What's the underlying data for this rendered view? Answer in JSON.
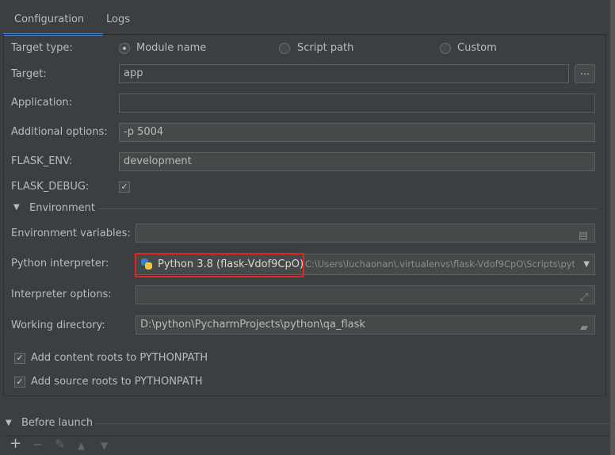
{
  "tabs": [
    {
      "label": "Configuration",
      "active": true
    },
    {
      "label": "Logs",
      "active": false
    }
  ],
  "target_type": {
    "label": "Target type:",
    "options": [
      {
        "label": "Module name",
        "selected": true
      },
      {
        "label": "Script path",
        "selected": false
      },
      {
        "label": "Custom",
        "selected": false
      }
    ]
  },
  "target": {
    "label": "Target:",
    "value": "app",
    "browse_label": "..."
  },
  "application": {
    "label": "Application:",
    "value": ""
  },
  "additional_options": {
    "label": "Additional options:",
    "value": "-p 5004"
  },
  "flask_env": {
    "label": "FLASK_ENV:",
    "value": "development"
  },
  "flask_debug": {
    "label": "FLASK_DEBUG:",
    "checked": true
  },
  "environment": {
    "title": "Environment",
    "env_vars": {
      "label": "Environment variables:",
      "value": ""
    },
    "interpreter": {
      "label": "Python interpreter:",
      "name": "Python 3.8 (flask-Vdof9CpO)",
      "path": "C:\\Users\\luchaonan\\.virtualenvs\\flask-Vdof9CpO\\Scripts\\pyt",
      "highlight_color": "#e8231f"
    },
    "interpreter_options": {
      "label": "Interpreter options:",
      "value": ""
    },
    "working_dir": {
      "label": "Working directory:",
      "value": "D:\\python\\PycharmProjects\\python\\qa_flask"
    },
    "content_roots": {
      "label": "Add content roots to PYTHONPATH",
      "checked": true
    },
    "source_roots": {
      "label": "Add source roots to PYTHONPATH",
      "checked": true
    }
  },
  "before_launch": {
    "title": "Before launch",
    "toolbar": [
      "add-icon",
      "remove-icon",
      "edit-icon",
      "move-up-icon",
      "move-down-icon"
    ]
  },
  "colors": {
    "background": "#3c3f41",
    "accent": "#4a88c7"
  }
}
